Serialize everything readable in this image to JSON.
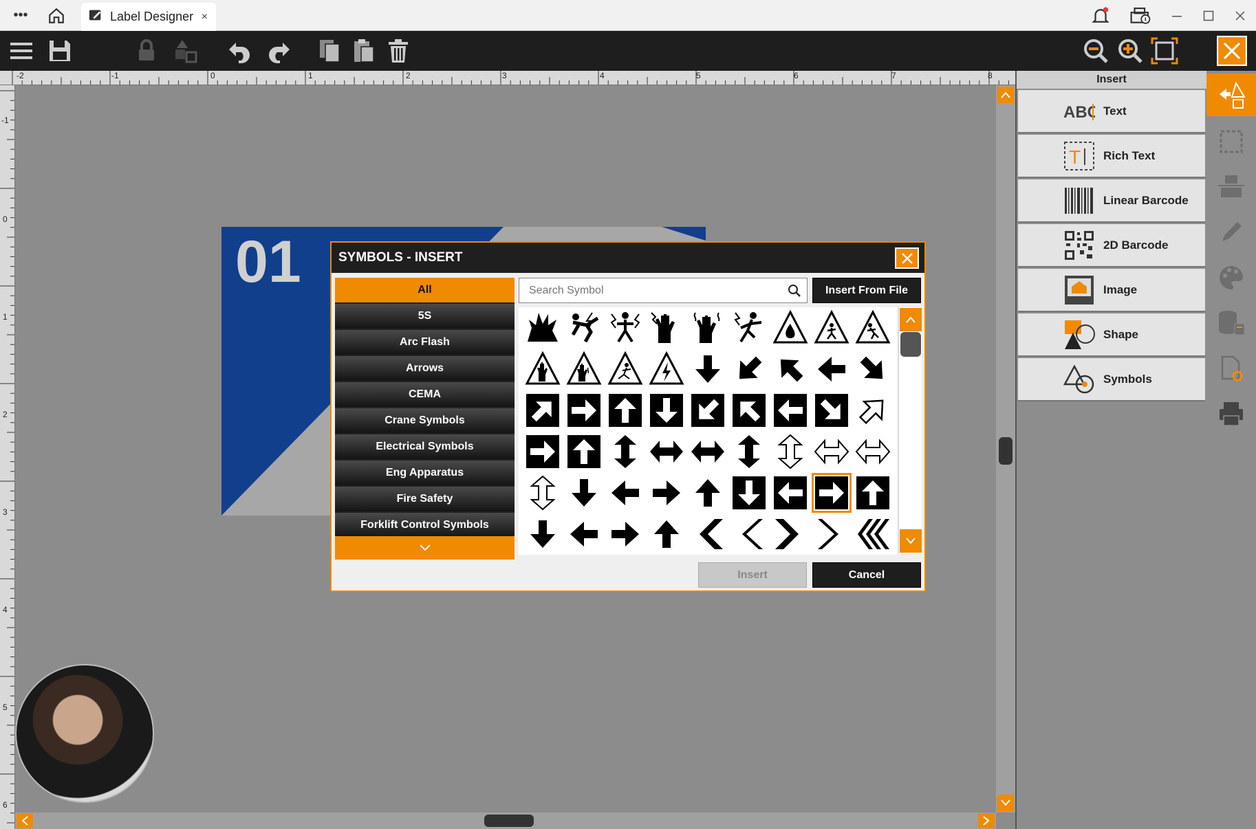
{
  "window": {
    "tab_title": "Label Designer",
    "close_glyph": "×",
    "menu_glyph": "•••"
  },
  "rulers": {
    "top": [
      "-2",
      "-1",
      "0",
      "1",
      "2",
      "3",
      "4",
      "5",
      "6",
      "7",
      "8"
    ],
    "left": [
      "-1",
      "0",
      "1",
      "2",
      "3",
      "4",
      "5",
      "6"
    ]
  },
  "label": {
    "number": "01",
    "colors": {
      "blue": "#113f8c",
      "card": "#a7a7a7"
    }
  },
  "insert_panel": {
    "title": "Insert",
    "items": [
      {
        "label": "Text",
        "icon": "text-abc-icon"
      },
      {
        "label": "Rich Text",
        "icon": "rich-text-icon"
      },
      {
        "label": "Linear Barcode",
        "icon": "linear-barcode-icon"
      },
      {
        "label": "2D Barcode",
        "icon": "qr-code-icon"
      },
      {
        "label": "Image",
        "icon": "image-icon"
      },
      {
        "label": "Shape",
        "icon": "shape-icon"
      },
      {
        "label": "Symbols",
        "icon": "symbols-icon"
      }
    ]
  },
  "dialog": {
    "title": "SYMBOLS - INSERT",
    "search_placeholder": "Search Symbol",
    "insert_from_file": "Insert From File",
    "insert": "Insert",
    "cancel": "Cancel",
    "categories": [
      "All",
      "5S",
      "Arc Flash",
      "Arrows",
      "CEMA",
      "Crane Symbols",
      "Electrical Symbols",
      "Eng Apparatus",
      "Fire Safety",
      "Forklift Control Symbols"
    ],
    "active_category": "All",
    "symbols": [
      "explosion-icon",
      "electric-shock-person-icon",
      "electric-shock-fall-icon",
      "hand-crush-icon",
      "hand-burn-icon",
      "person-shock-icon",
      "triangle-fire-icon",
      "triangle-person-icon",
      "triangle-fall-icon",
      "triangle-hand-icon",
      "triangle-hand-burn-icon",
      "triangle-person-slip-icon",
      "triangle-lightning-icon",
      "arrow-down-icon",
      "arrow-down-left-icon",
      "arrow-up-left-icon",
      "arrow-left-icon",
      "arrow-down-right-icon",
      "arrow-up-right-boxed-icon",
      "arrow-right-boxed-icon",
      "arrow-up-boxed-icon",
      "arrow-down-boxed-icon",
      "arrow-down-left-boxed-icon",
      "arrow-up-left-boxed-icon",
      "arrow-left-boxed-icon",
      "arrow-down-right-boxed-icon",
      "arrow-up-right-outlined-icon",
      "arrow-right-boxed-icon",
      "arrow-up-boxed-icon",
      "double-arrow-vertical-icon",
      "double-arrow-horizontal-icon",
      "double-arrow-horizontal-icon",
      "double-arrow-vertical-icon",
      "double-arrow-vertical-outline-icon",
      "double-arrow-horizontal-outline-icon",
      "double-arrow-horizontal-outline-icon",
      "double-arrow-vertical-outline-icon",
      "arrow-down-icon",
      "arrow-left-icon",
      "arrow-right-icon",
      "arrow-up-icon",
      "arrow-down-boxed-icon",
      "arrow-left-boxed-icon",
      "arrow-right-boxed-icon",
      "arrow-up-boxed-icon",
      "arrow-down-icon",
      "arrow-left-icon",
      "arrow-right-icon",
      "arrow-up-icon",
      "chevron-left-bold-icon",
      "chevron-left-icon",
      "chevron-right-bold-icon",
      "chevron-right-icon",
      "triple-chevron-left-icon"
    ],
    "selected_index": 43
  },
  "colors": {
    "accent": "#f08a00",
    "dark": "#1e1e1e"
  }
}
